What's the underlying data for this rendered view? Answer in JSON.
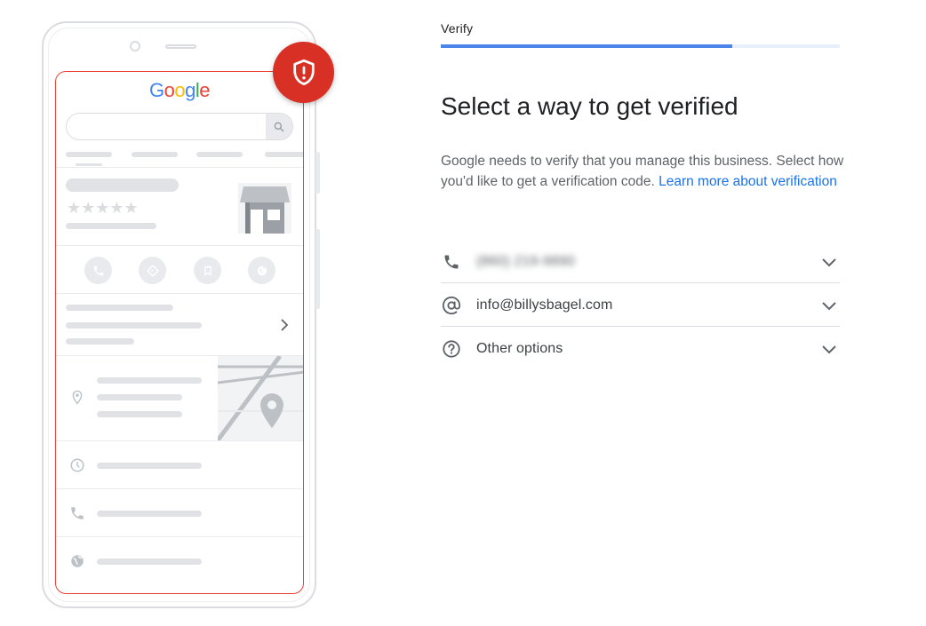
{
  "illustration": {
    "logo_letters": [
      "G",
      "o",
      "o",
      "g",
      "l",
      "e"
    ],
    "rating_stars": "★★★★★",
    "brand_colors": {
      "blue": "#4285f4",
      "red": "#ea4335",
      "yellow": "#fbbc05",
      "green": "#34a853",
      "alert": "#d93025"
    },
    "badge_icon": "shield-alert-icon"
  },
  "wizard": {
    "step_label": "Verify",
    "progress_fraction": 0.73,
    "accent_color": "#4a86e8"
  },
  "content": {
    "heading": "Select a way to get verified",
    "description": "Google needs to verify that you manage this business. Select how you'd like to get a verification code.",
    "learn_more": "Learn more about verification"
  },
  "options": [
    {
      "icon": "phone-icon",
      "label": "(860) 219-9890",
      "obscured": true
    },
    {
      "icon": "at-sign-icon",
      "label": "info@billysbagel.com",
      "obscured": false
    },
    {
      "icon": "help-circle-icon",
      "label": "Other options",
      "obscured": false
    }
  ]
}
